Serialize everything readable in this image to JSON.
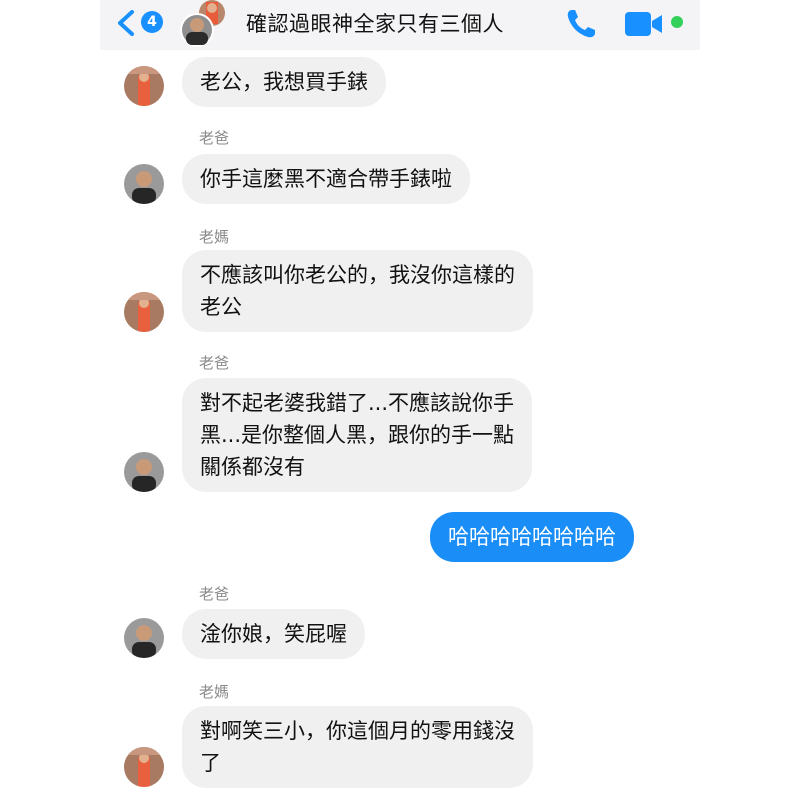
{
  "header": {
    "back_badge": "4",
    "title": "確認過眼神全家只有三個人",
    "accent_color": "#1990ff",
    "online_color": "#33d05a",
    "icons": [
      "chevron-left-icon",
      "phone-icon",
      "video-camera-icon"
    ]
  },
  "messages": [
    {
      "sender": "",
      "from": "mom",
      "outgoing": false,
      "lines": [
        "老公，我想買手錶"
      ]
    },
    {
      "sender": "老爸",
      "from": "dad",
      "outgoing": false,
      "lines": [
        "你手這麼黑不適合帶手錶啦"
      ]
    },
    {
      "sender": "老媽",
      "from": "mom",
      "outgoing": false,
      "lines": [
        "不應該叫你老公的，我沒你這樣的",
        "老公"
      ]
    },
    {
      "sender": "老爸",
      "from": "dad",
      "outgoing": false,
      "lines": [
        "對不起老婆我錯了...不應該說你手",
        "黑...是你整個人黑，跟你的手一點",
        "關係都沒有"
      ]
    },
    {
      "sender": "",
      "from": "me",
      "outgoing": true,
      "lines": [
        "哈哈哈哈哈哈哈哈"
      ]
    },
    {
      "sender": "老爸",
      "from": "dad",
      "outgoing": false,
      "lines": [
        "淦你娘，笑屁喔"
      ]
    },
    {
      "sender": "老媽",
      "from": "mom",
      "outgoing": false,
      "lines": [
        "對啊笑三小，你這個月的零用錢沒",
        "了"
      ]
    }
  ],
  "colors": {
    "incoming_bubble": "#f0f0f0",
    "outgoing_bubble": "#1a8df6",
    "sender_label": "#8a8a8a"
  }
}
